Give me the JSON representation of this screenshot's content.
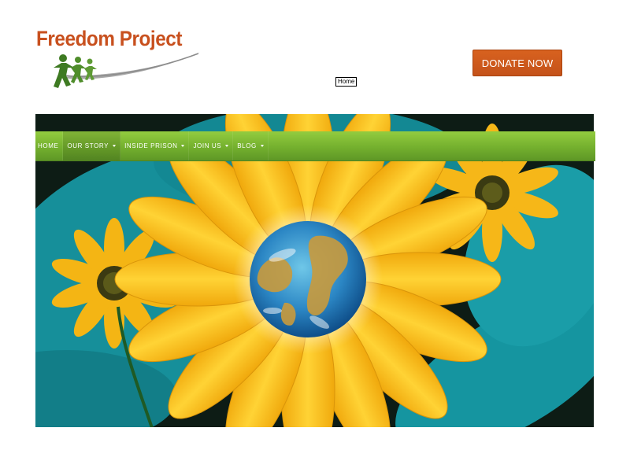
{
  "brand": {
    "name": "Freedom Project",
    "logo_mark": "people-swoosh-icon",
    "title_color": "#c8501e",
    "figure_color": "#3e7a22",
    "swoosh_color": "#9a9a9a"
  },
  "header": {
    "donate_label": "DONATE NOW",
    "donate_color": "#d05a1c",
    "home_link": "Home"
  },
  "nav": {
    "bar_color": "#7bb834",
    "items": [
      {
        "label": "HOME",
        "has_dropdown": false
      },
      {
        "label": "OUR STORY",
        "has_dropdown": true
      },
      {
        "label": "INSIDE PRISON",
        "has_dropdown": true
      },
      {
        "label": "JOIN US",
        "has_dropdown": true
      },
      {
        "label": "BLOG",
        "has_dropdown": true
      }
    ]
  },
  "hero": {
    "image": "sunflower-with-earth-center-illustration",
    "petal_color": "#f5b814",
    "leaf_color": "#1e9fa8"
  }
}
